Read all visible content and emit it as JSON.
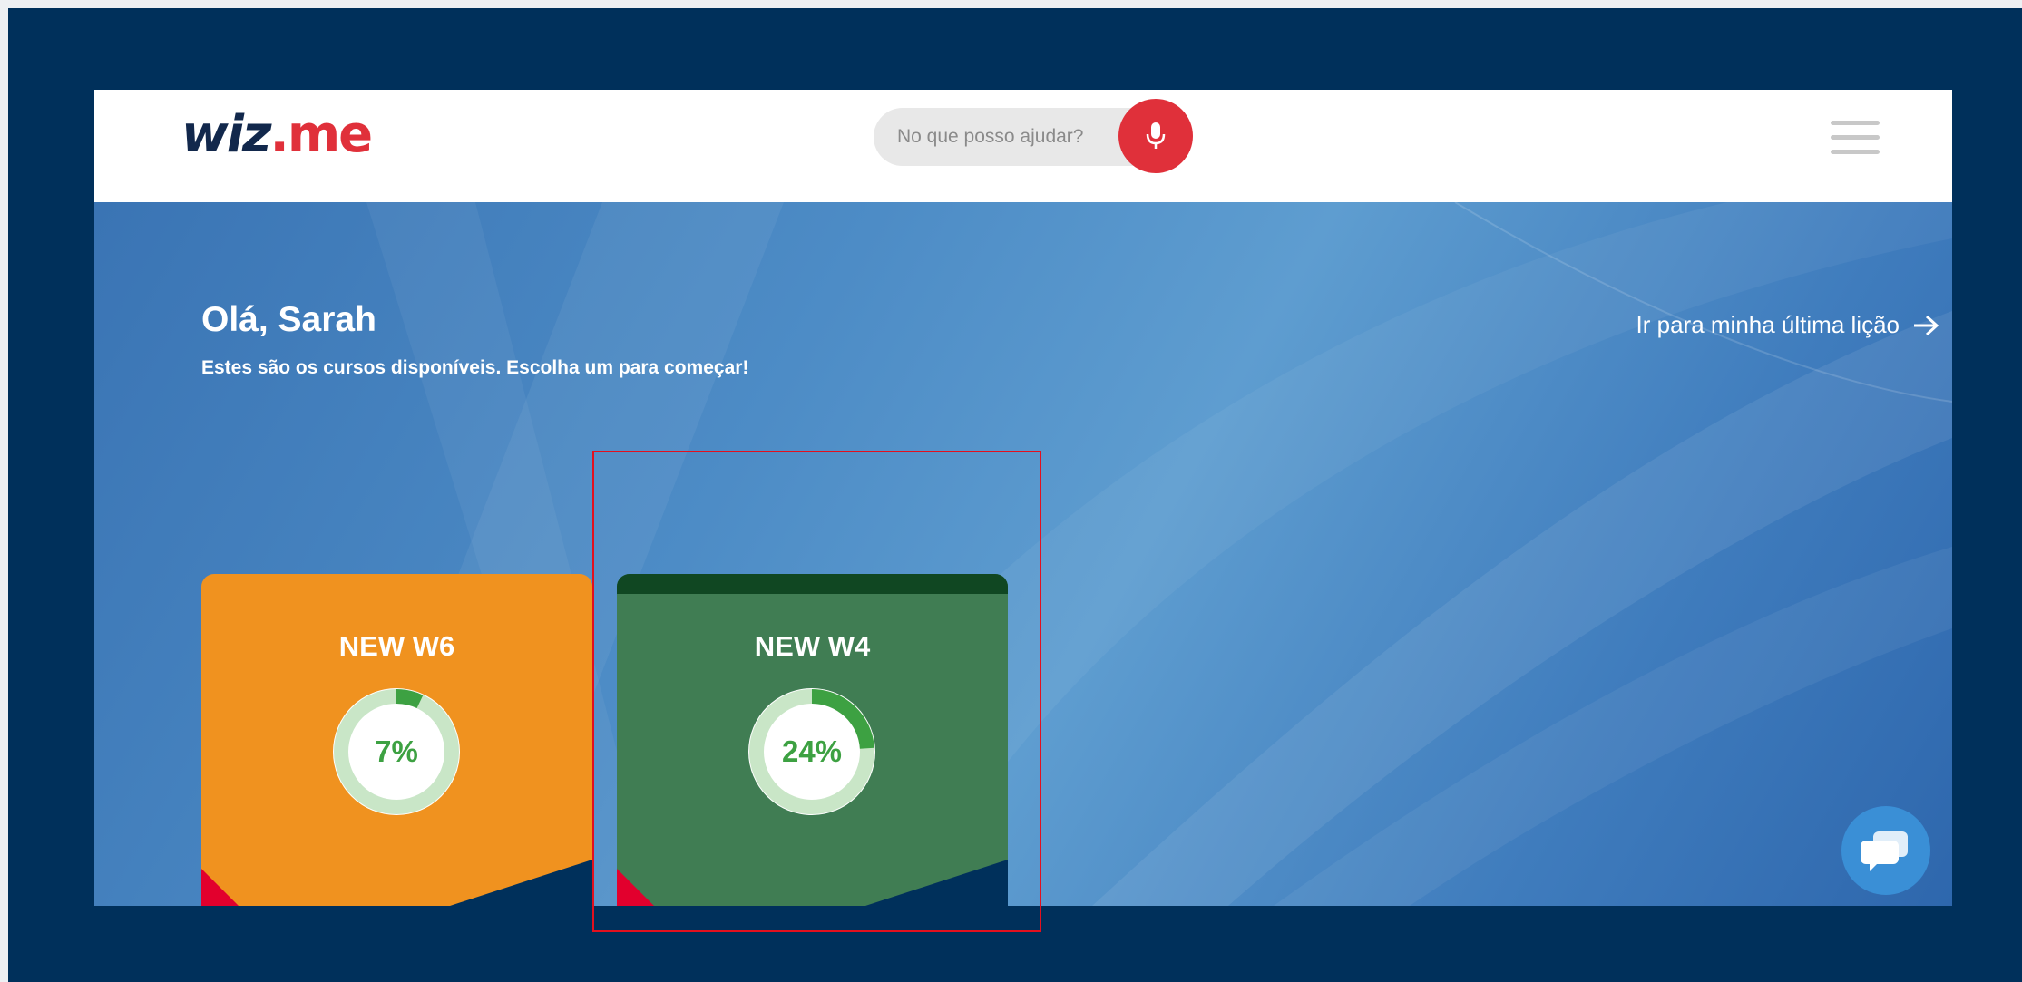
{
  "header": {
    "logo": {
      "wiz": "wiz",
      "dot": ".",
      "me": "me"
    },
    "search": {
      "placeholder": "No que posso ajudar?"
    },
    "mic_icon": "microphone-icon",
    "menu_icon": "hamburger-menu-icon"
  },
  "hero": {
    "greeting": "Olá, Sarah",
    "subtitle": "Estes são os cursos disponíveis. Escolha um para começar!",
    "last_lesson_link": "Ir para minha última lição",
    "last_lesson_icon": "arrow-right-icon"
  },
  "courses": [
    {
      "title": "NEW W6",
      "progress_label": "7%",
      "progress": 0.07,
      "color": "#f0921f"
    },
    {
      "title": "NEW W4",
      "progress_label": "24%",
      "progress": 0.24,
      "color": "#407d53",
      "topbar_color": "#104722"
    }
  ],
  "chat": {
    "icon": "chat-bubbles-icon"
  },
  "colors": {
    "frame": "#00305b",
    "accent_red": "#e0303a",
    "navy": "#00305b",
    "progress_green": "#3da142",
    "progress_track": "#c9e6c7"
  }
}
